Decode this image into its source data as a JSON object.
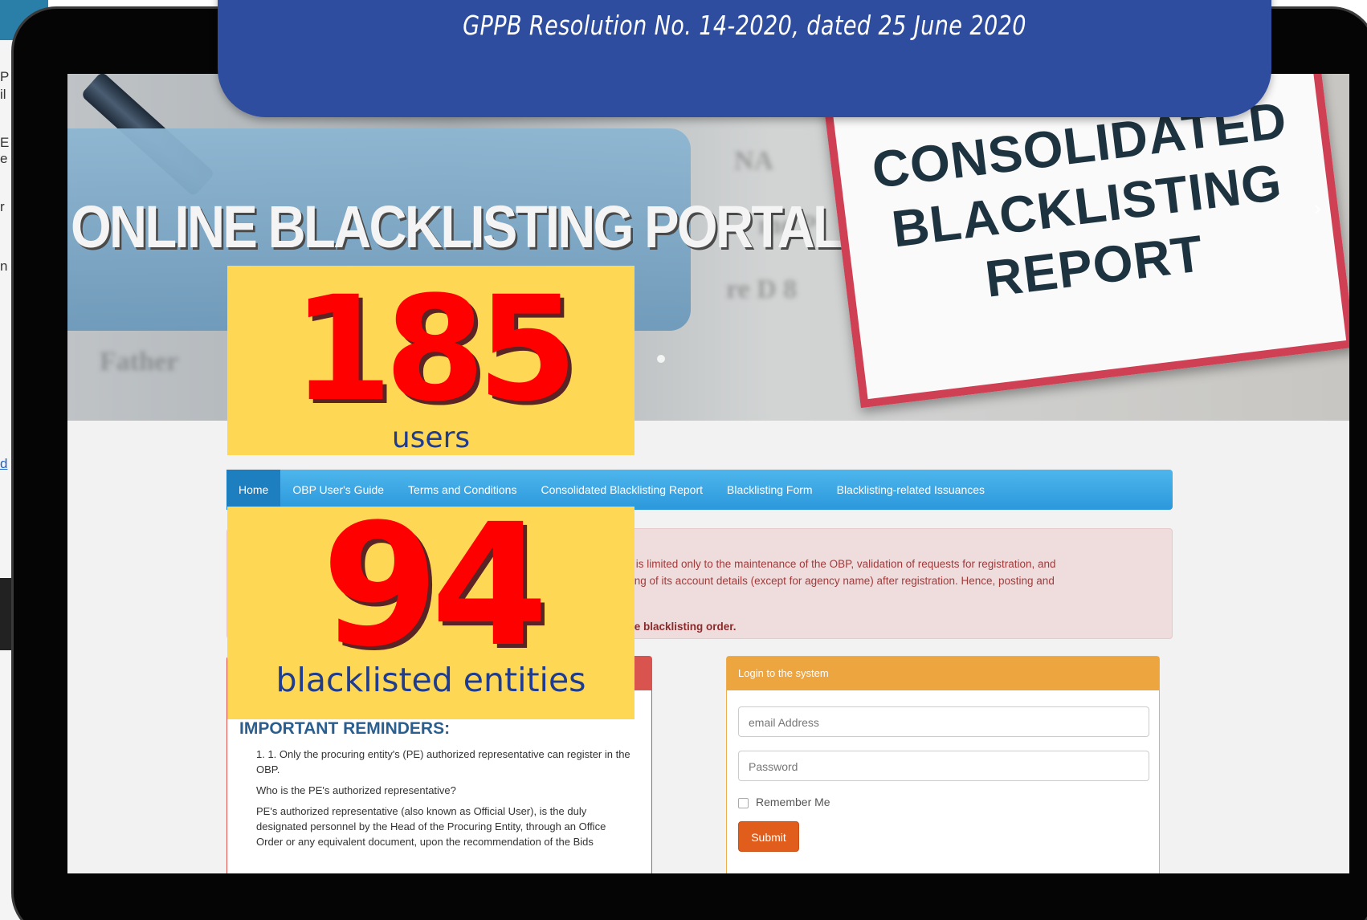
{
  "banner": {
    "subtitle": "GPPB Resolution No. 14-2020, dated 25 June 2020"
  },
  "hero": {
    "portal_title": "ONLINE BLACKLISTING PORTAL",
    "sign_line1": "CONSOLIDATED",
    "sign_line2": "BLACKLISTING",
    "sign_line3": "REPORT"
  },
  "stats": {
    "users_value": "185",
    "users_label": "users",
    "entities_value": "94",
    "entities_label": "blacklisted entities"
  },
  "nav": {
    "items": [
      "Home",
      "OBP User's Guide",
      "Terms and Conditions",
      "Consolidated Blacklisting Report",
      "Blacklisting Form",
      "Blacklisting-related Issuances"
    ]
  },
  "alert": {
    "line1": "Office is limited only to the maintenance of the OBP, validation of requests for registration, and",
    "line2": "updating of its account details (except for agency name) after registration. Hence, posting and",
    "line3": "ted the blacklisting order."
  },
  "reminders": {
    "title": "IMPORTANT REMINDERS:",
    "item1": "1. 1. Only the procuring entity's (PE) authorized representative can register in the OBP.",
    "item1_q": "Who is the PE's authorized representative?",
    "item1_a": "PE's authorized representative (also known as Official User), is the duly designated personnel by the Head of the Procuring Entity, through an Office Order or any equivalent document, upon the recommendation of the Bids"
  },
  "login": {
    "header": "Login to the system",
    "email_placeholder": "email Address",
    "password_placeholder": "Password",
    "remember_label": "Remember Me",
    "submit_label": "Submit"
  },
  "colors": {
    "banner_blue": "#2f4d9e",
    "stat_yellow": "#fed854",
    "stat_red": "#ff0000",
    "nav_blue": "#2b98dc",
    "login_orange": "#eda540",
    "submit_orange": "#e15d1c"
  }
}
